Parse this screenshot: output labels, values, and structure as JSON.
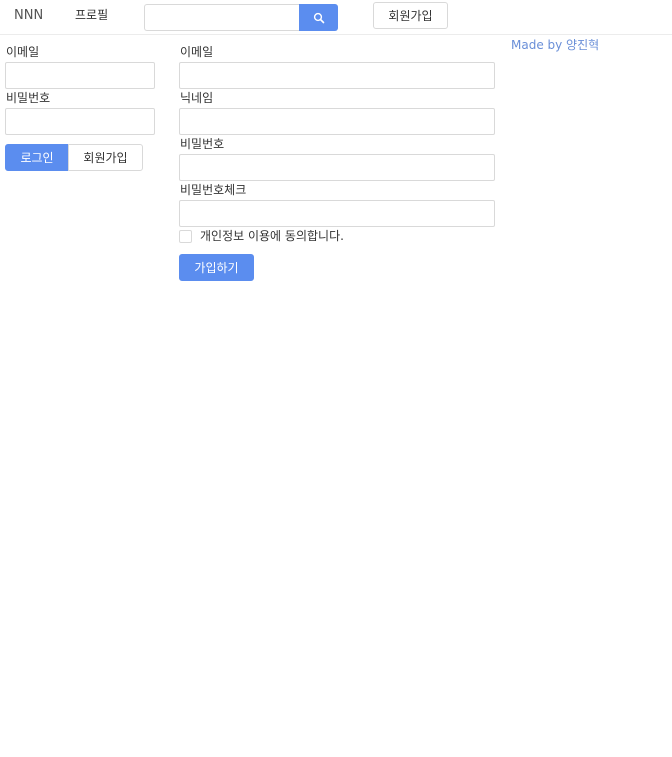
{
  "header": {
    "brand": "NNN",
    "profile_link": "프로필",
    "search_placeholder": "",
    "signup_button": "회원가입"
  },
  "login_form": {
    "email_label": "이메일",
    "password_label": "비밀번호",
    "login_button": "로그인",
    "signup_button": "회원가입"
  },
  "signup_form": {
    "email_label": "이메일",
    "nickname_label": "닉네임",
    "password_label": "비밀번호",
    "password_check_label": "비밀번호체크",
    "agree_label": "개인정보 이용에 동의합니다.",
    "submit_button": "가입하기"
  },
  "footer": {
    "made_by": "Made by 양진혁"
  },
  "colors": {
    "accent": "#5b8def",
    "link": "#6a8fd8",
    "border": "#d9d9d9"
  },
  "icons": {
    "search": "search-icon"
  }
}
